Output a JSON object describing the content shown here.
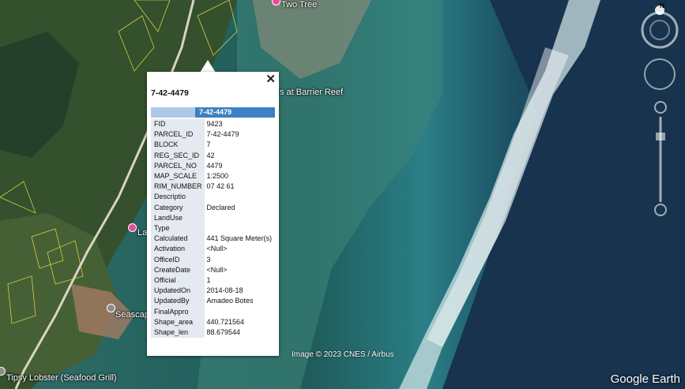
{
  "map": {
    "labels": {
      "two_tree": "Two Tree",
      "barrier_reef": "s at Barrier Reef",
      "tipsy_lobster": "Tipsy Lobster (Seafood Grill)",
      "seascape": "Seascap",
      "la": "La"
    },
    "credit": "Image © 2023 CNES / Airbus",
    "watermark": "Google Earth",
    "compass_letter": "N"
  },
  "balloon": {
    "title": "7-42-4479",
    "header": "7-42-4479",
    "close_symbol": "✕",
    "rows": [
      {
        "key": "FID",
        "value": "9423"
      },
      {
        "key": "PARCEL_ID",
        "value": "7-42-4479"
      },
      {
        "key": "BLOCK",
        "value": "7"
      },
      {
        "key": "REG_SEC_ID",
        "value": "42"
      },
      {
        "key": "PARCEL_NO",
        "value": "4479"
      },
      {
        "key": "MAP_SCALE",
        "value": "1:2500"
      },
      {
        "key": "RIM_NUMBER",
        "value": "07 42 61"
      },
      {
        "key": "Descriptio",
        "value": ""
      },
      {
        "key": "Category",
        "value": "Declared"
      },
      {
        "key": "LandUse",
        "value": ""
      },
      {
        "key": "Type",
        "value": ""
      },
      {
        "key": "Calculated",
        "value": "441 Square Meter(s)"
      },
      {
        "key": "Activation",
        "value": "<Null>"
      },
      {
        "key": "OfficeID",
        "value": "3"
      },
      {
        "key": "CreateDate",
        "value": "<Null>"
      },
      {
        "key": "Official",
        "value": "1"
      },
      {
        "key": "UpdatedOn",
        "value": "2014-08-18"
      },
      {
        "key": "UpdatedBy",
        "value": "Amadeo Botes"
      },
      {
        "key": "FinalAppro",
        "value": ""
      },
      {
        "key": "Shape_area",
        "value": "440.721564"
      },
      {
        "key": "Shape_len",
        "value": "88.679544"
      }
    ]
  }
}
